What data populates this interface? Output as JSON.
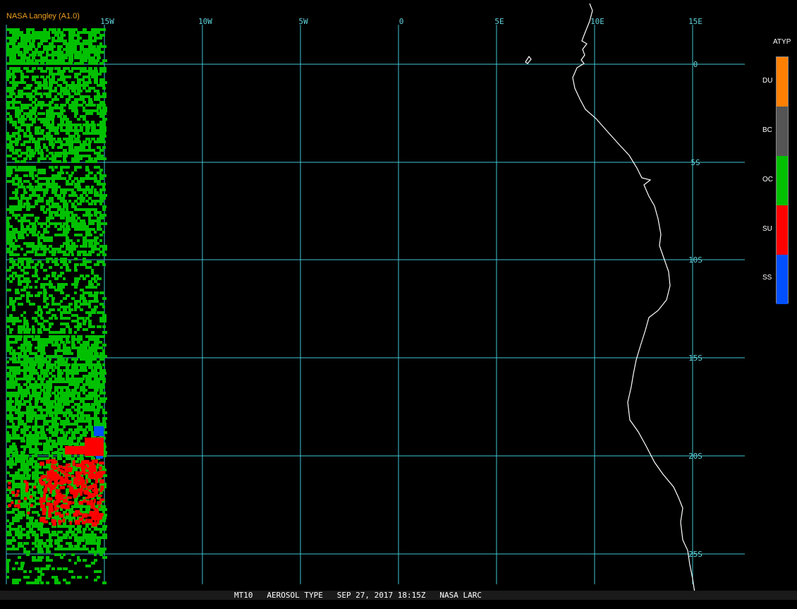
{
  "credit": "NASA Langley (A1.0)",
  "lon_labels": [
    "15W",
    "10W",
    "5W",
    "0",
    "5E",
    "10E",
    "15E"
  ],
  "lat_labels": [
    "0",
    "5S",
    "10S",
    "15S",
    "20S",
    "25S"
  ],
  "legend": {
    "title": "ATYP",
    "items": [
      {
        "label": "DU",
        "color": "#ff8000"
      },
      {
        "label": "BC",
        "color": "#555555"
      },
      {
        "label": "OC",
        "color": "#00c000"
      },
      {
        "label": "SU",
        "color": "#ff0000"
      },
      {
        "label": "SS",
        "color": "#0050ff"
      }
    ]
  },
  "status": "MT10   AEROSOL TYPE   SEP 27, 2017 18:15Z   NASA LARC",
  "colors": {
    "grid": "#3fc6d2",
    "coast": "#ffffff",
    "credit": "#f0a020"
  }
}
